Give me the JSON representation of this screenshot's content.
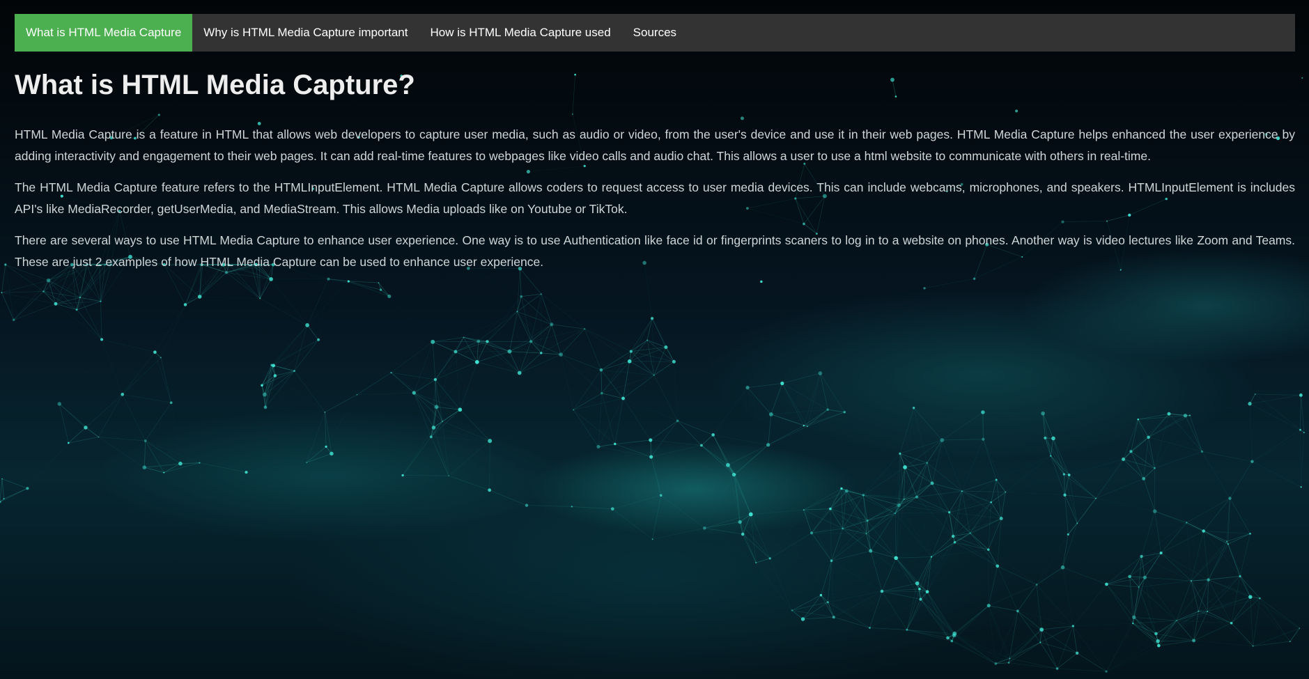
{
  "nav": {
    "items": [
      {
        "label": "What is HTML Media Capture",
        "active": true
      },
      {
        "label": "Why is HTML Media Capture important",
        "active": false
      },
      {
        "label": "How is HTML Media Capture used",
        "active": false
      },
      {
        "label": "Sources",
        "active": false
      }
    ]
  },
  "main": {
    "heading": "What is HTML Media Capture?",
    "paragraphs": [
      "HTML Media Capture is a feature in HTML that allows web developers to capture user media, such as audio or video, from the user's device and use it in their web pages. HTML Media Capture helps enhanced the user experience by adding interactivity and engagement to their web pages. It can add real-time features to webpages like video calls and audio chat. This allows a user to use a html website to communicate with others in real-time.",
      "The HTML Media Capture feature refers to the HTMLInputElement. HTML Media Capture allows coders to request access to user media devices. This can include webcams, microphones, and speakers. HTMLInputElement is includes API's like MediaRecorder, getUserMedia, and MediaStream. This allows Media uploads like on Youtube or TikTok.",
      "There are several ways to use HTML Media Capture to enhance user experience. One way is to use Authentication like face id or fingerprints scaners to log in to a website on phones. Another way is video lectures like Zoom and Teams. These are just 2 examples of how HTML Media Capture can be used to enhance user experience."
    ]
  },
  "colors": {
    "nav_background": "#333333",
    "nav_active": "#4caf50",
    "page_background": "#04101a",
    "network_accent": "#3fe0d0"
  }
}
